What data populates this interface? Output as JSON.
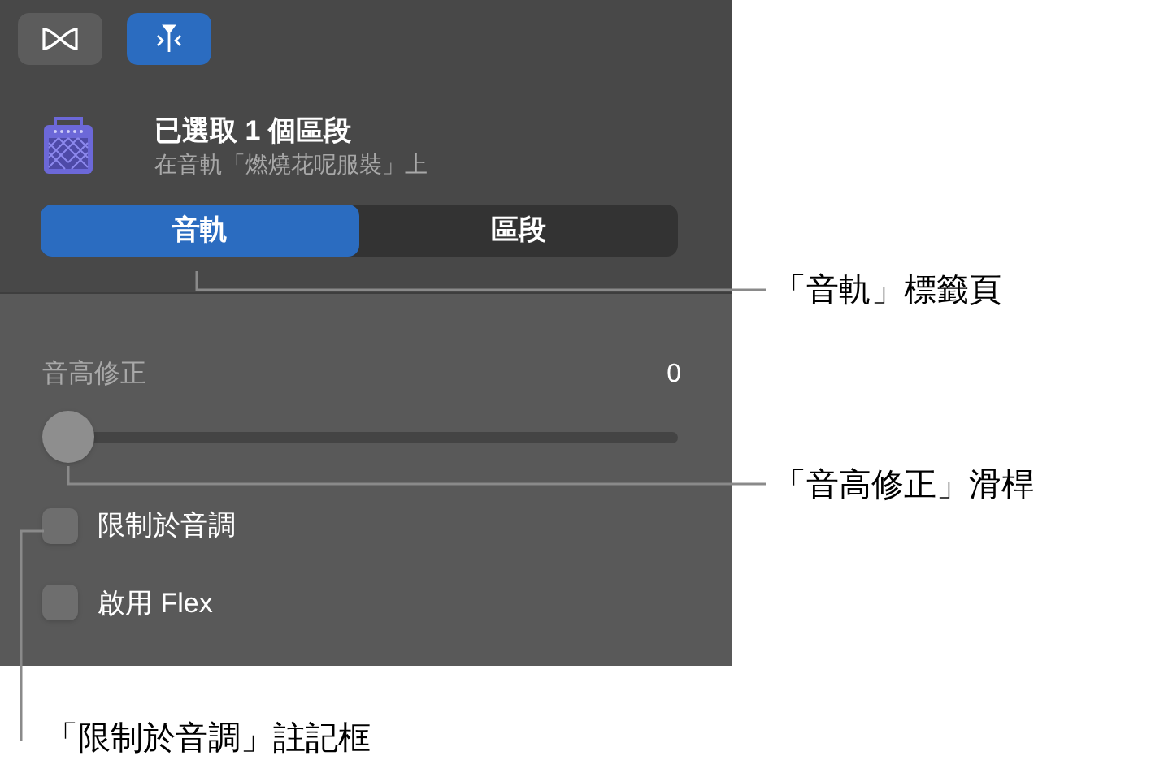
{
  "toolbar": {
    "buttons": [
      {
        "kind": "smart-controls",
        "selected": false
      },
      {
        "kind": "pitch",
        "selected": true
      }
    ]
  },
  "header": {
    "title": "已選取 1 個區段",
    "subtitle": "在音軌「燃燒花呢服裝」上"
  },
  "tabs": [
    {
      "label": "音軌",
      "selected": true
    },
    {
      "label": "區段",
      "selected": false
    }
  ],
  "pitch_correction": {
    "label": "音高修正",
    "reading": "0",
    "level": 0
  },
  "checkboxes": [
    {
      "label": "限制於音調",
      "checked": false
    },
    {
      "label": "啟用 Flex",
      "checked": false
    }
  ],
  "callouts": [
    "「音軌」標籤頁",
    "「音高修正」滑桿",
    "「限制於音調」註記框"
  ]
}
